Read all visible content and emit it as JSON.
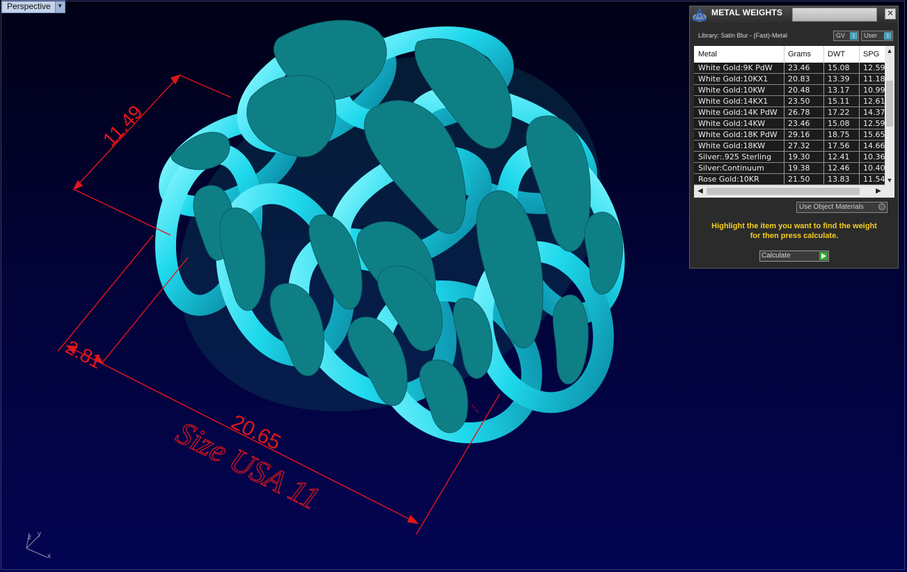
{
  "viewport": {
    "name": "Perspective",
    "dimensions": {
      "width_top": "11.49",
      "thickness": "2.81",
      "length": "20.65"
    },
    "engraving": "Size USA 11",
    "axis": {
      "x": "x",
      "y": "y",
      "z": "z"
    },
    "colors": {
      "model": "#26d8ee",
      "dimension": "#e0161a",
      "background": "#02033a"
    }
  },
  "panel": {
    "title": "METAL WEIGHTS",
    "close_glyph": "✕",
    "library_label": "Library: Satin Blur - (Fast)-Metal",
    "toggle_gv": "GV",
    "toggle_user": "User",
    "columns": [
      "Metal",
      "Grams",
      "DWT",
      "SPG"
    ],
    "rows": [
      {
        "metal": "White Gold:9K PdW",
        "grams": "23.46",
        "dwt": "15.08",
        "spg": "12.59"
      },
      {
        "metal": "White Gold:10KX1",
        "grams": "20.83",
        "dwt": "13.39",
        "spg": "11.18"
      },
      {
        "metal": "White Gold:10KW",
        "grams": "20.48",
        "dwt": "13.17",
        "spg": "10.99"
      },
      {
        "metal": "White Gold:14KX1",
        "grams": "23.50",
        "dwt": "15.11",
        "spg": "12.61"
      },
      {
        "metal": "White Gold:14K PdW",
        "grams": "26.78",
        "dwt": "17.22",
        "spg": "14.37"
      },
      {
        "metal": "White Gold:14KW",
        "grams": "23.46",
        "dwt": "15.08",
        "spg": "12.59"
      },
      {
        "metal": "White Gold:18K PdW",
        "grams": "29.16",
        "dwt": "18.75",
        "spg": "15.65"
      },
      {
        "metal": "White Gold:18KW",
        "grams": "27.32",
        "dwt": "17.56",
        "spg": "14.66"
      },
      {
        "metal": "Silver:.925 Sterling",
        "grams": "19.30",
        "dwt": "12.41",
        "spg": "10.36"
      },
      {
        "metal": "Silver:Continuum",
        "grams": "19.38",
        "dwt": "12.46",
        "spg": "10.40"
      },
      {
        "metal": "Rose Gold:10KR",
        "grams": "21.50",
        "dwt": "13.83",
        "spg": "11.54"
      }
    ],
    "use_object_materials": "Use Object Materials",
    "hint_line1": "Highlight the item you want to find the weight",
    "hint_line2": "for then press calculate.",
    "calculate": "Calculate",
    "icons": {
      "logo": "rhino-logo-icon",
      "close": "close-icon",
      "play": "play-icon"
    },
    "colors": {
      "hint": "#f5cf22",
      "accent": "#4f9fb8",
      "play": "#3da13a"
    }
  }
}
